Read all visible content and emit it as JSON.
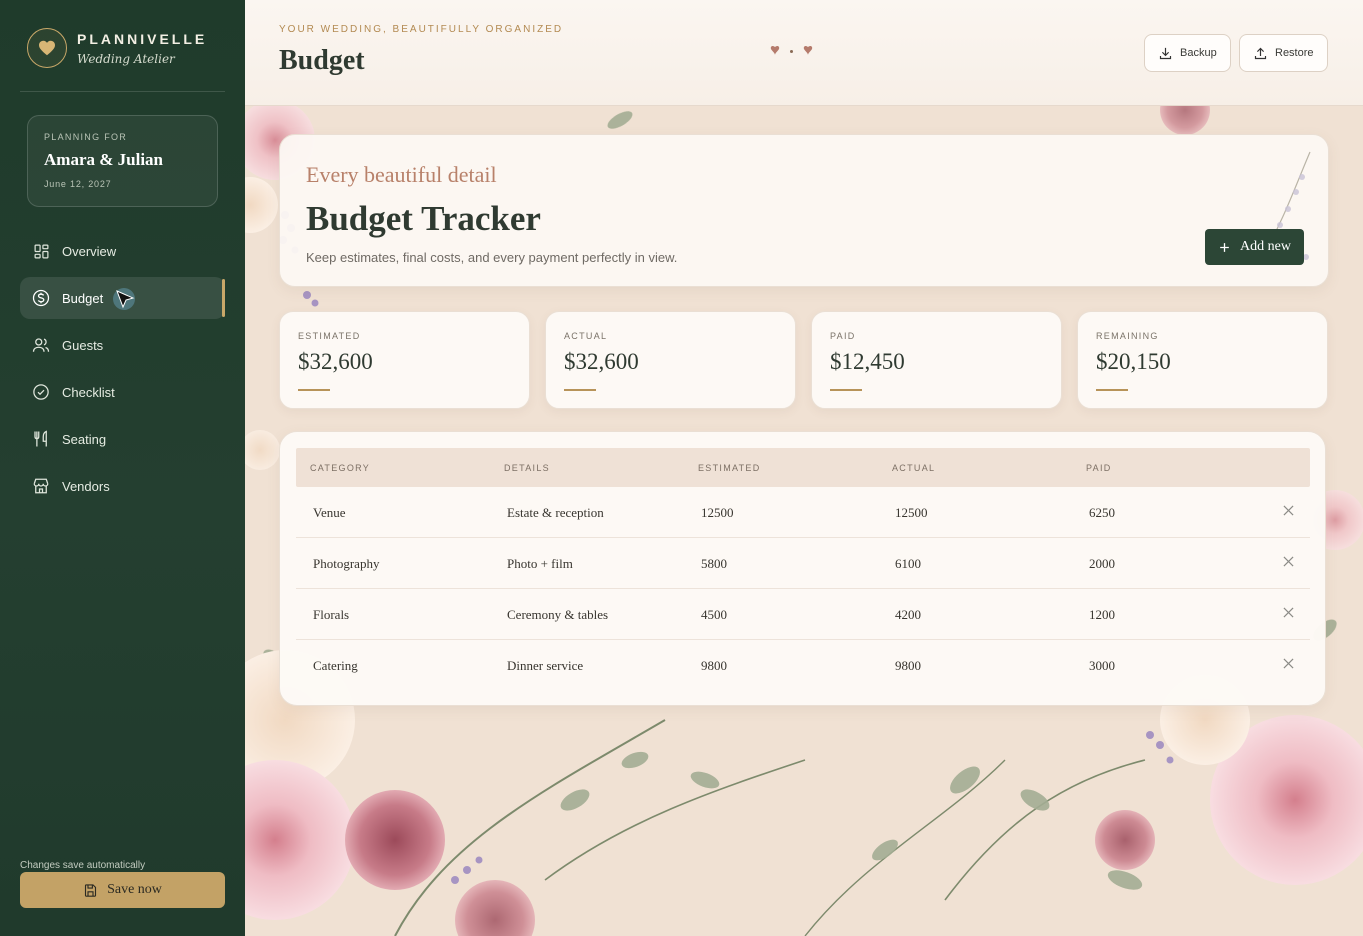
{
  "brand": {
    "name": "PLANNIVELLE",
    "subtitle": "Wedding Atelier"
  },
  "planning": {
    "label": "PLANNING FOR",
    "names": "Amara & Julian",
    "date": "June 12, 2027"
  },
  "nav": [
    {
      "label": "Overview",
      "icon": "grid-icon",
      "active": false
    },
    {
      "label": "Budget",
      "icon": "dollar-icon",
      "active": true
    },
    {
      "label": "Guests",
      "icon": "users-icon",
      "active": false
    },
    {
      "label": "Checklist",
      "icon": "check-circle-icon",
      "active": false
    },
    {
      "label": "Seating",
      "icon": "utensils-icon",
      "active": false
    },
    {
      "label": "Vendors",
      "icon": "store-icon",
      "active": false
    }
  ],
  "footer": {
    "autosave": "Changes save automatically",
    "save_label": "Save now"
  },
  "header": {
    "eyebrow": "YOUR WEDDING, BEAUTIFULLY ORGANIZED",
    "title": "Budget",
    "backup_label": "Backup",
    "restore_label": "Restore"
  },
  "hero": {
    "eyebrow": "Every beautiful detail",
    "title": "Budget Tracker",
    "description": "Keep estimates, final costs, and every payment perfectly in view.",
    "add_label": "Add new"
  },
  "stats": [
    {
      "label": "ESTIMATED",
      "value": "$32,600"
    },
    {
      "label": "ACTUAL",
      "value": "$32,600"
    },
    {
      "label": "PAID",
      "value": "$12,450"
    },
    {
      "label": "REMAINING",
      "value": "$20,150"
    }
  ],
  "table": {
    "columns": [
      "CATEGORY",
      "DETAILS",
      "ESTIMATED",
      "ACTUAL",
      "PAID"
    ],
    "rows": [
      {
        "category": "Venue",
        "details": "Estate & reception",
        "estimated": "12500",
        "actual": "12500",
        "paid": "6250"
      },
      {
        "category": "Photography",
        "details": "Photo + film",
        "estimated": "5800",
        "actual": "6100",
        "paid": "2000"
      },
      {
        "category": "Florals",
        "details": "Ceremony & tables",
        "estimated": "4500",
        "actual": "4200",
        "paid": "1200"
      },
      {
        "category": "Catering",
        "details": "Dinner service",
        "estimated": "9800",
        "actual": "9800",
        "paid": "3000"
      }
    ]
  },
  "colors": {
    "sidebar": "#1f3b2b",
    "accent_gold": "#c3a266",
    "primary_button": "#2c4636",
    "rose_text": "#b8816a"
  }
}
